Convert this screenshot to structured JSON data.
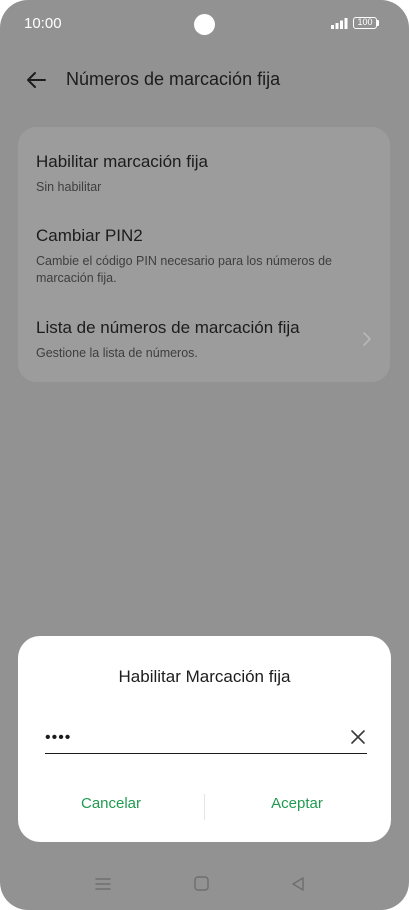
{
  "status_bar": {
    "time": "10:00",
    "battery": "100"
  },
  "header": {
    "title": "Números de marcación fija"
  },
  "settings": {
    "items": [
      {
        "title": "Habilitar marcación fija",
        "subtitle": "Sin habilitar"
      },
      {
        "title": "Cambiar PIN2",
        "subtitle": "Cambie el código PIN necesario para los números de marcación fija."
      },
      {
        "title": "Lista de números de marcación fija",
        "subtitle": "Gestione la lista de números."
      }
    ]
  },
  "dialog": {
    "title": "Habilitar Marcación fija",
    "pin_value": "••••",
    "cancel_label": "Cancelar",
    "accept_label": "Aceptar"
  },
  "colors": {
    "accent": "#1f9a4f",
    "scrim": "#929292",
    "dialog_bg": "#ffffff"
  },
  "icons": [
    "back-arrow-icon",
    "chevron-right-icon",
    "clear-icon",
    "signal-icon",
    "battery-icon",
    "recents-icon",
    "home-icon",
    "back-triangle-icon"
  ]
}
